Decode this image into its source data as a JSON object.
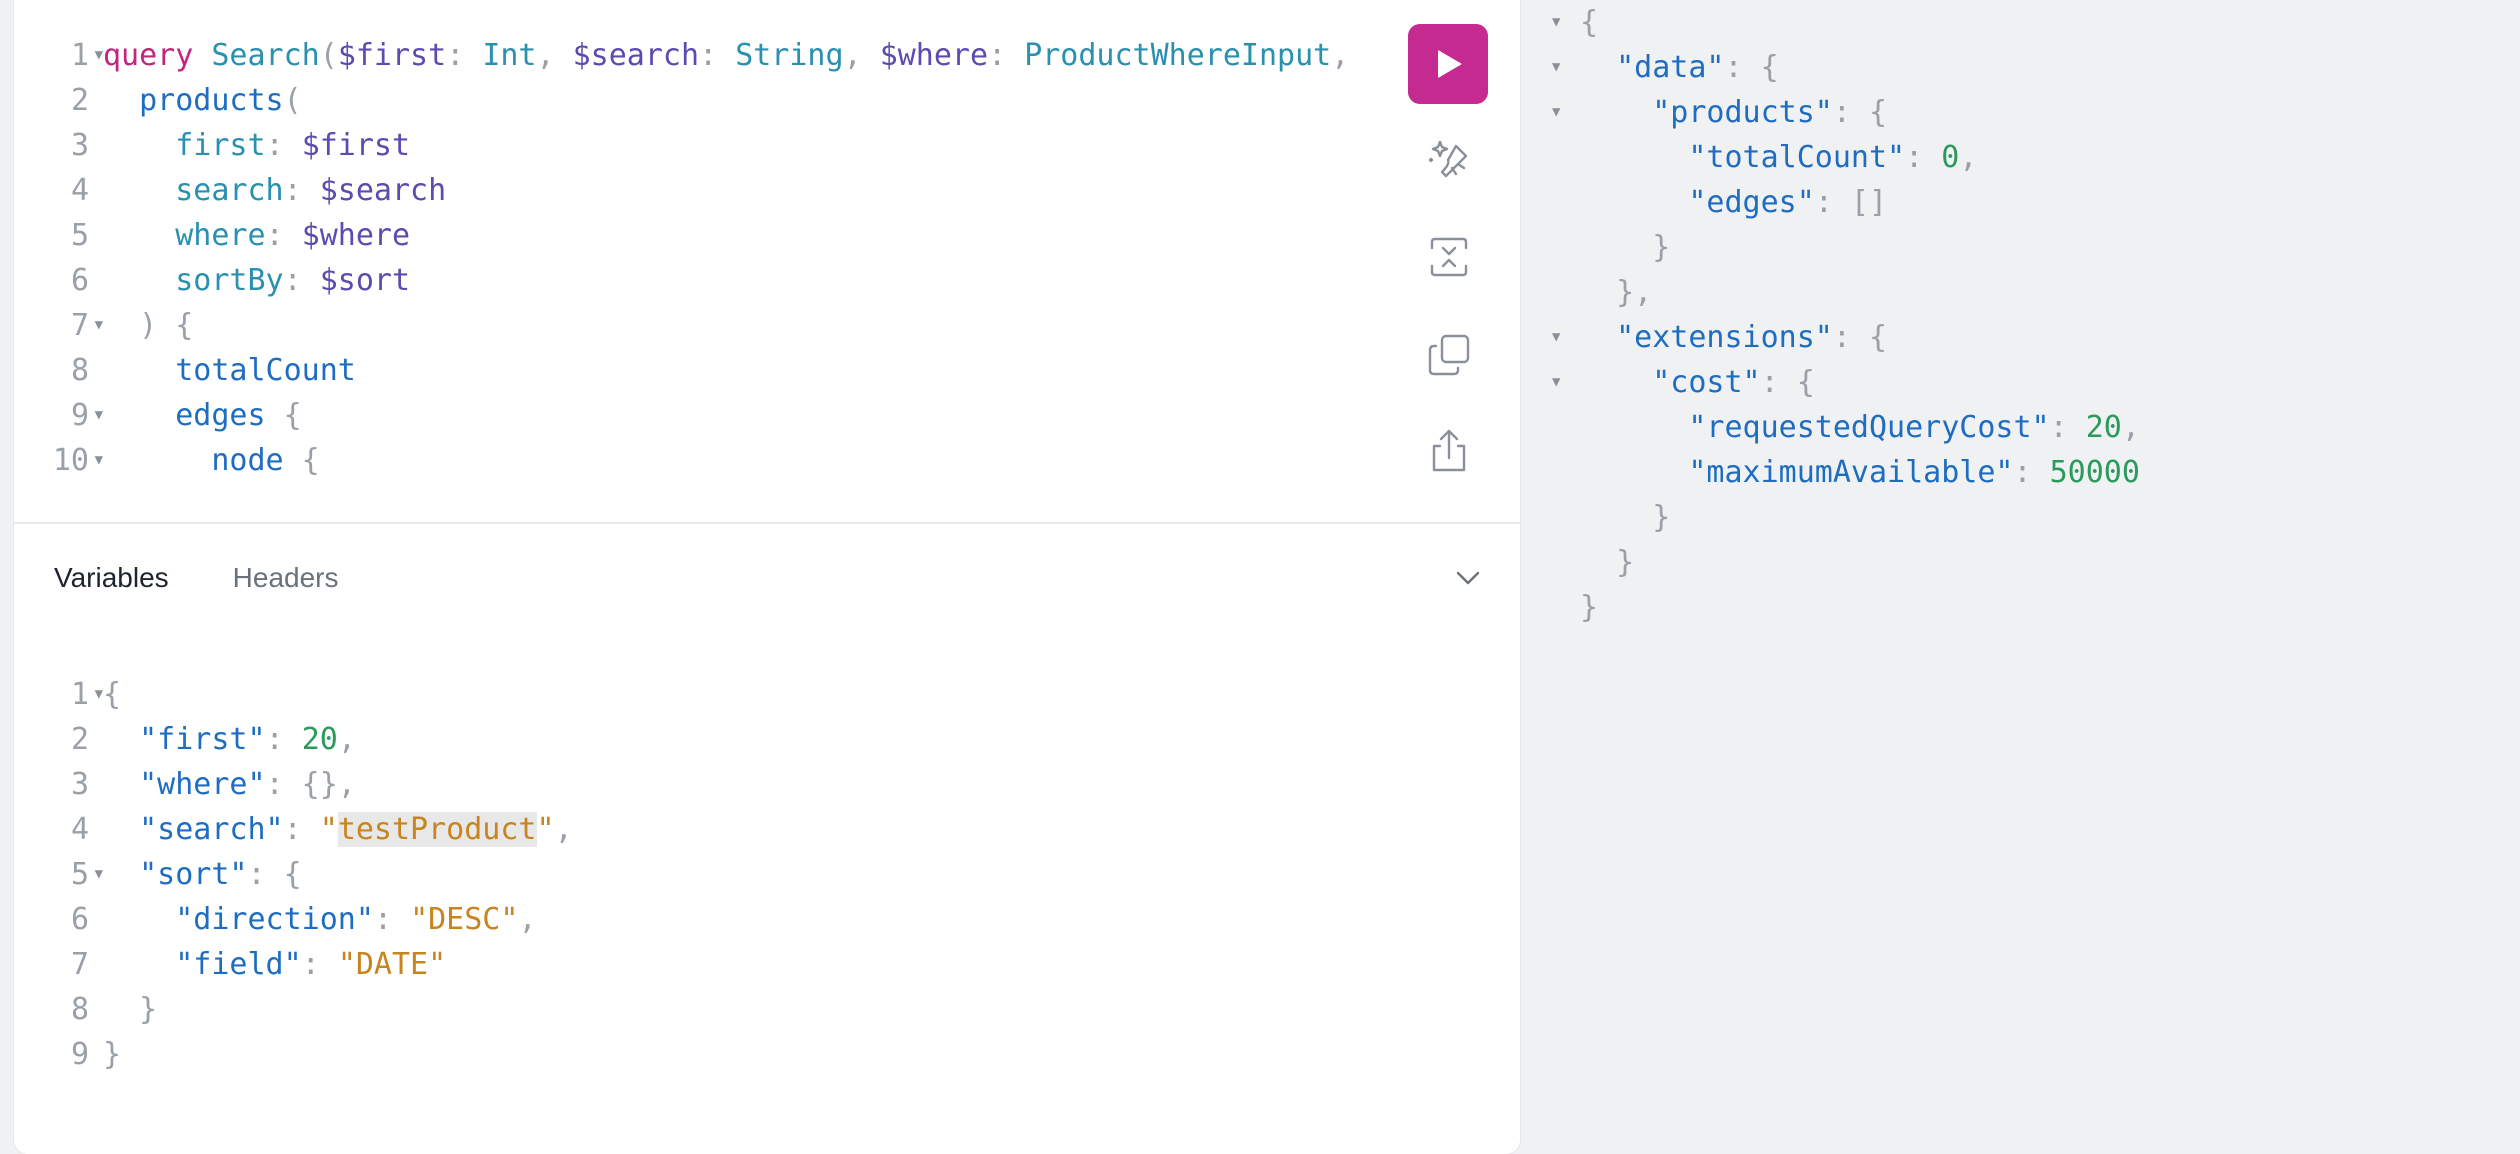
{
  "query_editor": {
    "lines": [
      {
        "n": "1",
        "fold": true,
        "tokens": [
          [
            "kw",
            "query"
          ],
          [
            "punc",
            " "
          ],
          [
            "def",
            "Search"
          ],
          [
            "punc",
            "("
          ],
          [
            "var",
            "$first"
          ],
          [
            "punc",
            ": "
          ],
          [
            "type",
            "Int"
          ],
          [
            "punc",
            ", "
          ],
          [
            "var",
            "$search"
          ],
          [
            "punc",
            ": "
          ],
          [
            "type",
            "String"
          ],
          [
            "punc",
            ", "
          ],
          [
            "var",
            "$where"
          ],
          [
            "punc",
            ": "
          ],
          [
            "type",
            "ProductWhereInput"
          ],
          [
            "punc",
            ","
          ]
        ]
      },
      {
        "n": "2",
        "fold": false,
        "tokens": [
          [
            "punc",
            "  "
          ],
          [
            "field",
            "products"
          ],
          [
            "punc",
            "("
          ]
        ]
      },
      {
        "n": "3",
        "fold": false,
        "tokens": [
          [
            "punc",
            "    "
          ],
          [
            "def",
            "first"
          ],
          [
            "punc",
            ": "
          ],
          [
            "var",
            "$first"
          ]
        ]
      },
      {
        "n": "4",
        "fold": false,
        "tokens": [
          [
            "punc",
            "    "
          ],
          [
            "def",
            "search"
          ],
          [
            "punc",
            ": "
          ],
          [
            "var",
            "$search"
          ]
        ]
      },
      {
        "n": "5",
        "fold": false,
        "tokens": [
          [
            "punc",
            "    "
          ],
          [
            "def",
            "where"
          ],
          [
            "punc",
            ": "
          ],
          [
            "var",
            "$where"
          ]
        ]
      },
      {
        "n": "6",
        "fold": false,
        "tokens": [
          [
            "punc",
            "    "
          ],
          [
            "def",
            "sortBy"
          ],
          [
            "punc",
            ": "
          ],
          [
            "var",
            "$sort"
          ]
        ]
      },
      {
        "n": "7",
        "fold": true,
        "tokens": [
          [
            "punc",
            "  ) {"
          ]
        ]
      },
      {
        "n": "8",
        "fold": false,
        "tokens": [
          [
            "punc",
            "    "
          ],
          [
            "field",
            "totalCount"
          ]
        ]
      },
      {
        "n": "9",
        "fold": true,
        "tokens": [
          [
            "punc",
            "    "
          ],
          [
            "field",
            "edges"
          ],
          [
            "punc",
            " {"
          ]
        ]
      },
      {
        "n": "10",
        "fold": true,
        "tokens": [
          [
            "punc",
            "      "
          ],
          [
            "field",
            "node"
          ],
          [
            "punc",
            " {"
          ]
        ]
      }
    ]
  },
  "toolbar": {
    "run_icon": "play-icon",
    "prettify_icon": "magic-wand-icon",
    "merge_icon": "merge-fragments-icon",
    "copy_icon": "copy-icon",
    "share_icon": "share-icon"
  },
  "tabs": {
    "variables": "Variables",
    "headers": "Headers"
  },
  "variables_editor": {
    "lines": [
      {
        "n": "1",
        "fold": true,
        "tokens": [
          [
            "punc",
            "{"
          ]
        ]
      },
      {
        "n": "2",
        "fold": false,
        "tokens": [
          [
            "punc",
            "  "
          ],
          [
            "prop",
            "\"first\""
          ],
          [
            "punc",
            ": "
          ],
          [
            "num-v",
            "20"
          ],
          [
            "punc",
            ","
          ]
        ]
      },
      {
        "n": "3",
        "fold": false,
        "tokens": [
          [
            "punc",
            "  "
          ],
          [
            "prop",
            "\"where\""
          ],
          [
            "punc",
            ": {},"
          ]
        ]
      },
      {
        "n": "4",
        "fold": false,
        "tokens": [
          [
            "punc",
            "  "
          ],
          [
            "prop",
            "\"search\""
          ],
          [
            "punc",
            ": "
          ],
          [
            "str",
            "\""
          ],
          [
            "str hl",
            "testProduct"
          ],
          [
            "str",
            "\""
          ],
          [
            "punc",
            ","
          ]
        ]
      },
      {
        "n": "5",
        "fold": true,
        "tokens": [
          [
            "punc",
            "  "
          ],
          [
            "prop",
            "\"sort\""
          ],
          [
            "punc",
            ": {"
          ]
        ]
      },
      {
        "n": "6",
        "fold": false,
        "tokens": [
          [
            "punc",
            "    "
          ],
          [
            "prop",
            "\"direction\""
          ],
          [
            "punc",
            ": "
          ],
          [
            "str",
            "\"DESC\""
          ],
          [
            "punc",
            ","
          ]
        ]
      },
      {
        "n": "7",
        "fold": false,
        "tokens": [
          [
            "punc",
            "    "
          ],
          [
            "prop",
            "\"field\""
          ],
          [
            "punc",
            ": "
          ],
          [
            "str",
            "\"DATE\""
          ]
        ]
      },
      {
        "n": "8",
        "fold": false,
        "tokens": [
          [
            "punc",
            "  }"
          ]
        ]
      },
      {
        "n": "9",
        "fold": false,
        "tokens": [
          [
            "punc",
            "}"
          ]
        ]
      }
    ]
  },
  "result": {
    "lines": [
      {
        "fold": true,
        "tokens": [
          [
            "punc",
            "{"
          ]
        ]
      },
      {
        "fold": true,
        "tokens": [
          [
            "punc",
            "  "
          ],
          [
            "prop",
            "\"data\""
          ],
          [
            "punc",
            ": {"
          ]
        ]
      },
      {
        "fold": true,
        "tokens": [
          [
            "punc",
            "    "
          ],
          [
            "prop",
            "\"products\""
          ],
          [
            "punc",
            ": {"
          ]
        ]
      },
      {
        "fold": false,
        "tokens": [
          [
            "punc",
            "      "
          ],
          [
            "prop",
            "\"totalCount\""
          ],
          [
            "punc",
            ": "
          ],
          [
            "num-v",
            "0"
          ],
          [
            "punc",
            ","
          ]
        ]
      },
      {
        "fold": false,
        "tokens": [
          [
            "punc",
            "      "
          ],
          [
            "prop",
            "\"edges\""
          ],
          [
            "punc",
            ": []"
          ]
        ]
      },
      {
        "fold": false,
        "tokens": [
          [
            "punc",
            "    }"
          ]
        ]
      },
      {
        "fold": false,
        "tokens": [
          [
            "punc",
            "  },"
          ]
        ]
      },
      {
        "fold": true,
        "tokens": [
          [
            "punc",
            "  "
          ],
          [
            "prop",
            "\"extensions\""
          ],
          [
            "punc",
            ": {"
          ]
        ]
      },
      {
        "fold": true,
        "tokens": [
          [
            "punc",
            "    "
          ],
          [
            "prop",
            "\"cost\""
          ],
          [
            "punc",
            ": {"
          ]
        ]
      },
      {
        "fold": false,
        "tokens": [
          [
            "punc",
            "      "
          ],
          [
            "prop",
            "\"requestedQueryCost\""
          ],
          [
            "punc",
            ": "
          ],
          [
            "num-v",
            "20"
          ],
          [
            "punc",
            ","
          ]
        ]
      },
      {
        "fold": false,
        "tokens": [
          [
            "punc",
            "      "
          ],
          [
            "prop",
            "\"maximumAvailable\""
          ],
          [
            "punc",
            ": "
          ],
          [
            "num-v",
            "50000"
          ]
        ]
      },
      {
        "fold": false,
        "tokens": [
          [
            "punc",
            "    }"
          ]
        ]
      },
      {
        "fold": false,
        "tokens": [
          [
            "punc",
            "  }"
          ]
        ]
      },
      {
        "fold": false,
        "tokens": [
          [
            "punc",
            "}"
          ]
        ]
      }
    ]
  },
  "colors": {
    "accent": "#c42a8f",
    "keyword": "#c2257d",
    "string": "#c8841e",
    "number": "#2c9a5c",
    "property": "#1f6dc0"
  }
}
